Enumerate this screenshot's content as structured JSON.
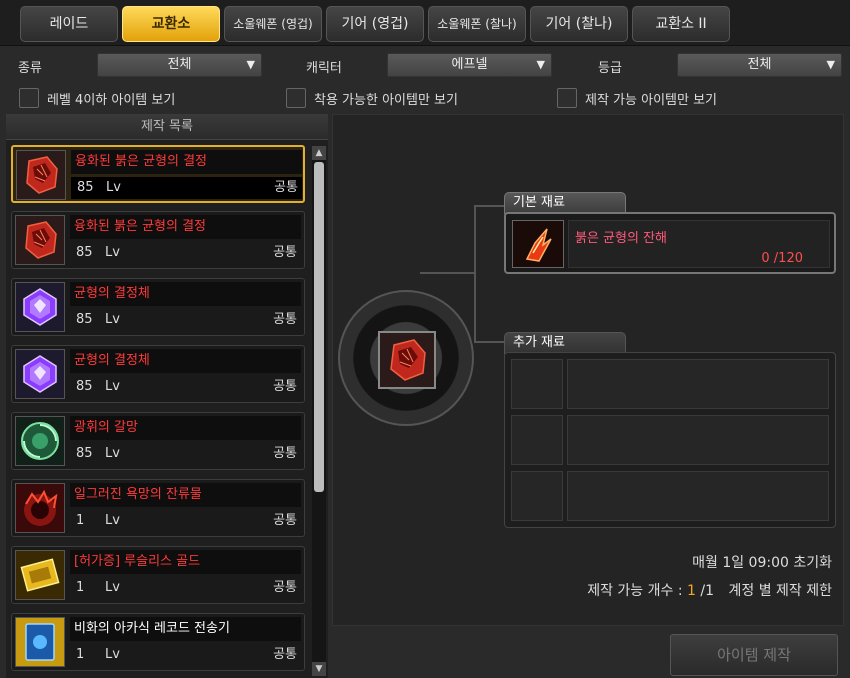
{
  "tabs": [
    "레이드",
    "교환소",
    "소울웨폰 (영겁)",
    "기어 (영겁)",
    "소울웨폰 (찰나)",
    "기어 (찰나)",
    "교환소 II"
  ],
  "active_tab": "교환소",
  "filters": {
    "type_label": "종류",
    "type_value": "전체",
    "char_label": "캐릭터",
    "char_value": "에프넬",
    "grade_label": "등급",
    "grade_value": "전체"
  },
  "checkboxes": [
    "레벨 4이하 아이템 보기",
    "착용 가능한 아이템만 보기",
    "제작 가능 아이템만 보기"
  ],
  "list": {
    "header": "제작 목록",
    "items": [
      {
        "name": "융화된 붉은 균형의 결정",
        "level": "85",
        "lv": "Lv",
        "class": "공통",
        "icon": "red-crystal-icon"
      },
      {
        "name": "융화된 붉은 균형의 결정",
        "level": "85",
        "lv": "Lv",
        "class": "공통",
        "icon": "red-crystal-icon"
      },
      {
        "name": "균형의 결정체",
        "level": "85",
        "lv": "Lv",
        "class": "공통",
        "icon": "purple-gem-icon"
      },
      {
        "name": "균형의 결정체",
        "level": "85",
        "lv": "Lv",
        "class": "공통",
        "icon": "purple-gem-icon"
      },
      {
        "name": "광휘의 갈망",
        "level": "85",
        "lv": "Lv",
        "class": "공통",
        "icon": "green-orb-icon"
      },
      {
        "name": "일그러진 욕망의 잔류물",
        "level": "1",
        "lv": "Lv",
        "class": "공통",
        "icon": "red-residue-icon"
      },
      {
        "name": "[허가증] 루슬리스 골드",
        "level": "1",
        "lv": "Lv",
        "class": "공통",
        "icon": "gold-ticket-icon"
      },
      {
        "name": "비화의 아카식 레코드 전송기",
        "level": "1",
        "lv": "Lv",
        "class": "공통",
        "icon": "blue-card-icon"
      }
    ]
  },
  "materials": {
    "basic_label": "기본 재료",
    "basic_item_name": "붉은 균형의 잔해",
    "basic_item_count": "0 /120",
    "extra_label": "추가 재료"
  },
  "info": {
    "reset": "매월 1일 09:00 초기화",
    "craft_count_label": "제작 가능 개수 :",
    "craft_count_current": "1",
    "craft_count_max": "/1",
    "account_limit": "계정 별 제작 제한"
  },
  "craft_button": "아이템 제작",
  "colors": {
    "active_tab": "#f5c02a",
    "item_red_name": "#ff3a3a",
    "count_red": "#ff4d4d",
    "count_current": "#f5a623"
  }
}
